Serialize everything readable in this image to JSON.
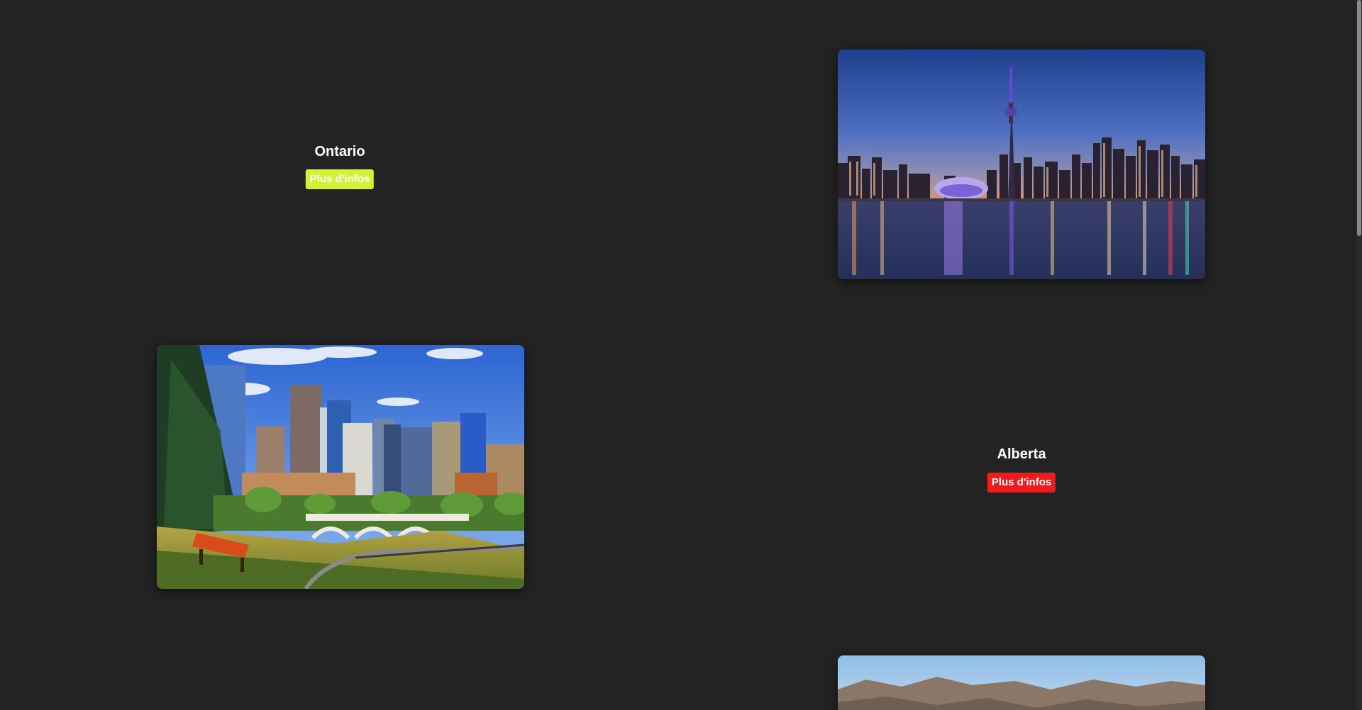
{
  "sections": [
    {
      "title": "Ontario",
      "button_label": "Plus d'infos",
      "button_color": "#d4f233",
      "image": "toronto-skyline-night"
    },
    {
      "title": "Alberta",
      "button_label": "Plus d'infos",
      "button_color": "#ee1c1c",
      "image": "calgary-skyline-park"
    },
    {
      "image": "mountain-landscape"
    }
  ],
  "colors": {
    "page_background": "#232323",
    "text": "#ffffff"
  }
}
